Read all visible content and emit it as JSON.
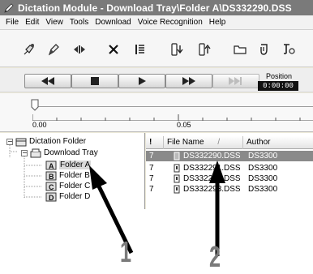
{
  "window": {
    "title": "Dictation Module - Download Tray\\Folder A\\DS332290.DSS"
  },
  "menubar": {
    "items": [
      "File",
      "Edit",
      "View",
      "Tools",
      "Download",
      "Voice Recognition",
      "Help"
    ]
  },
  "toolbar": {
    "icons": [
      "record-mic-icon",
      "dictation-pen-icon",
      "index-mark-icon",
      "delete-x-icon",
      "file-properties-icon",
      "download-to-pc-icon",
      "upload-icon",
      "new-folder-icon",
      "send-mail-icon",
      "voice-recognition-icon"
    ]
  },
  "transport": {
    "buttons": [
      "rewind",
      "stop",
      "play",
      "fast-forward",
      "end"
    ],
    "position_label": "Position",
    "position_value": "0:00:00"
  },
  "slider": {
    "scale_start": "0.00",
    "scale_mid": "0.05"
  },
  "tree": {
    "root": "Dictation Folder",
    "download_tray": "Download Tray",
    "folders": [
      "Folder A",
      "Folder B",
      "Folder C",
      "Folder D"
    ],
    "selected": "Folder A"
  },
  "file_list": {
    "columns": {
      "priority": "!",
      "file_name": "File Name",
      "sort_indicator": "/",
      "author": "Author"
    },
    "rows": [
      {
        "priority": "7",
        "file_name": "DS332290.DSS",
        "author": "DS3300",
        "selected": true
      },
      {
        "priority": "7",
        "file_name": "DS332291.DSS",
        "author": "DS3300",
        "selected": false
      },
      {
        "priority": "7",
        "file_name": "DS332292.DSS",
        "author": "DS3300",
        "selected": false
      },
      {
        "priority": "7",
        "file_name": "DS332293.DSS",
        "author": "DS3300",
        "selected": false
      }
    ]
  },
  "callouts": {
    "one": "1",
    "two": "2"
  },
  "colors": {
    "titlebar": "#7a7a7a",
    "selected_row": "#8a8a8a",
    "arrow": "#000000",
    "callout_number": "#7a7a7a"
  }
}
